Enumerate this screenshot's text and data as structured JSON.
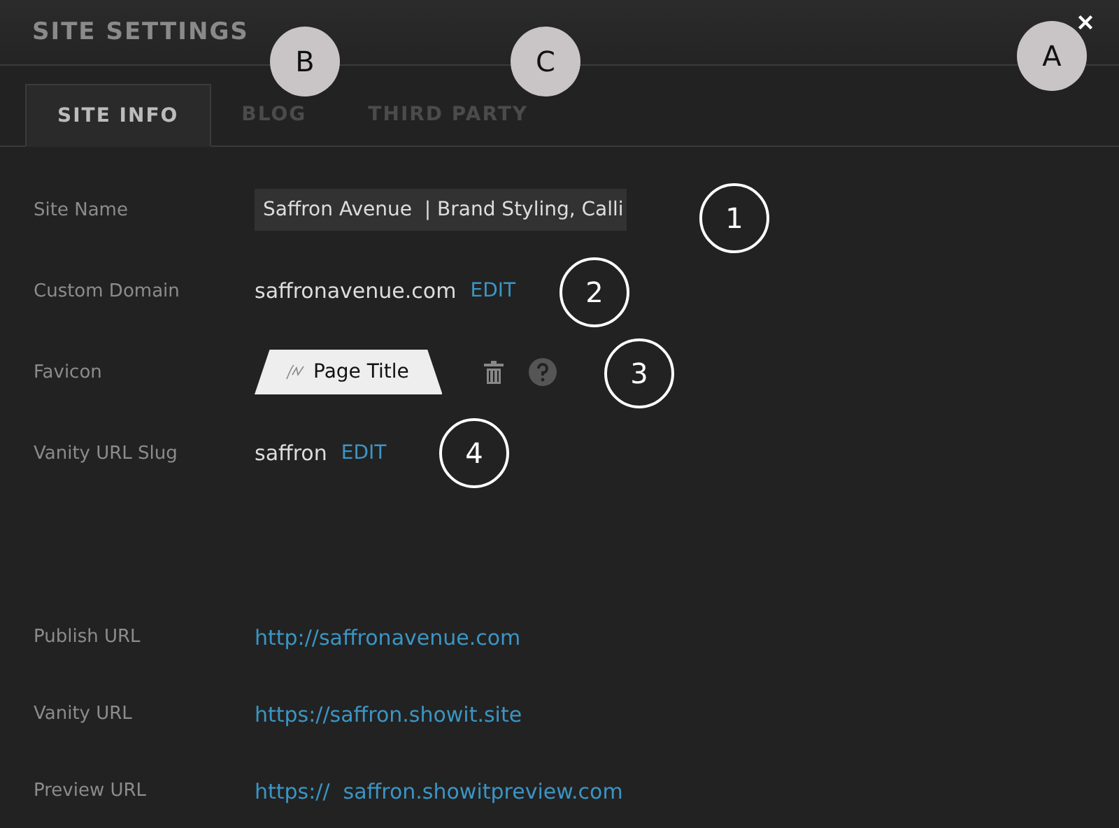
{
  "window": {
    "title": "SITE SETTINGS"
  },
  "tabs": [
    {
      "label": "SITE INFO",
      "selected": true
    },
    {
      "label": "BLOG",
      "selected": false
    },
    {
      "label": "THIRD PARTY",
      "selected": false
    }
  ],
  "settings": [
    {
      "kind": "field",
      "label": "Site Name",
      "value": "Saffron Avenue  | Brand Styling, Calli"
    },
    {
      "kind": "editable",
      "label": "Custom Domain",
      "value": "saffronavenue.com",
      "action": "EDIT"
    },
    {
      "kind": "favicon",
      "label": "Favicon",
      "preview_title": "Page Title"
    },
    {
      "kind": "editable",
      "label": "Vanity URL Slug",
      "value": "saffron",
      "action": "EDIT"
    }
  ],
  "urls": [
    {
      "label": "Publish URL",
      "link": "http://saffronavenue.com"
    },
    {
      "label": "Vanity URL",
      "link": "https://saffron.showit.site"
    },
    {
      "label": "Preview URL",
      "link": "https://  saffron.showitpreview.com"
    }
  ],
  "callouts": [
    {
      "label": "B",
      "kind": "filled"
    },
    {
      "label": "C",
      "kind": "filled"
    },
    {
      "label": "A",
      "kind": "filled"
    },
    {
      "label": "1",
      "kind": "outline"
    },
    {
      "label": "2",
      "kind": "outline"
    },
    {
      "label": "3",
      "kind": "outline"
    },
    {
      "label": "4",
      "kind": "outline"
    }
  ]
}
